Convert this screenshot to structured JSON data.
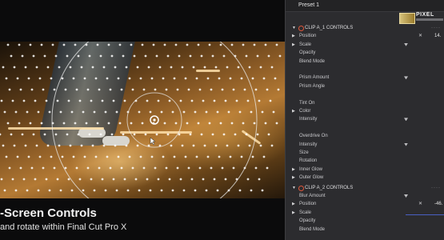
{
  "caption": {
    "title": "-Screen Controls",
    "subtitle": "and rotate within Final Cut Pro X"
  },
  "inspector": {
    "preset": "Preset 1",
    "logo": {
      "text": "PIXEL"
    },
    "clip1": {
      "title": "CLIP A_1 CONTROLS",
      "params": [
        {
          "label": "Position",
          "arrow": true,
          "x": true,
          "value": "14."
        },
        {
          "label": "Scale",
          "arrow": true,
          "knob": true
        },
        {
          "label": "Opacity"
        },
        {
          "label": "Blend Mode"
        },
        {
          "label": ""
        },
        {
          "label": "Prism Amount",
          "knob": true
        },
        {
          "label": "Prism Angle"
        },
        {
          "label": ""
        },
        {
          "label": "Tint On"
        },
        {
          "label": "Color",
          "arrow": true
        },
        {
          "label": "Intensity",
          "knob": true
        },
        {
          "label": ""
        },
        {
          "label": "Overdrive On"
        },
        {
          "label": "Intensity",
          "knob": true
        },
        {
          "label": "Size"
        },
        {
          "label": "Rotation"
        },
        {
          "label": "Inner Glow",
          "arrow": true
        },
        {
          "label": "Outer Glow",
          "arrow": true
        }
      ]
    },
    "clip2": {
      "title": "CLIP A_2 CONTROLS",
      "params": [
        {
          "label": "Blur Amount",
          "knob": true
        },
        {
          "label": "Position",
          "arrow": true,
          "x": true,
          "value": "-46."
        },
        {
          "label": "Scale",
          "arrow": true,
          "slider": true
        },
        {
          "label": "Opacity"
        },
        {
          "label": "Blend Mode"
        }
      ]
    }
  }
}
